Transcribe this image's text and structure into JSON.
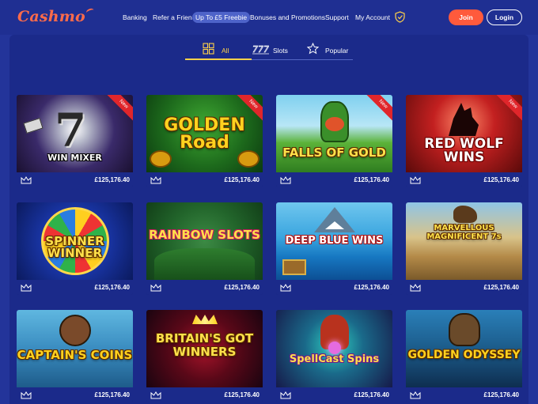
{
  "header": {
    "logo": "Cashmo",
    "nav": [
      {
        "label": "Banking"
      },
      {
        "label": "Refer a Friend"
      },
      {
        "label": "Up To £5 Freebie"
      },
      {
        "label": "Bonuses and Promotions"
      },
      {
        "label": "Support"
      },
      {
        "label": "My Account"
      }
    ],
    "join": "Join",
    "login": "Login",
    "icons": {
      "shield": "shield-check-icon"
    }
  },
  "filters": {
    "tabs": [
      {
        "label": "All",
        "icon": "grid-icon",
        "active": true
      },
      {
        "label": "Slots",
        "icon": "777-icon",
        "active": false
      },
      {
        "label": "Popular",
        "icon": "star-icon",
        "active": false
      }
    ]
  },
  "games": [
    {
      "title": "WIN MIXER",
      "jackpot": "£125,176.40",
      "new_badge": "New"
    },
    {
      "title": "GOLDEN Road",
      "jackpot": "£125,176.40",
      "new_badge": "New"
    },
    {
      "title": "FALLS OF GOLD",
      "jackpot": "£125,176.40",
      "new_badge": "New"
    },
    {
      "title": "RED WOLF WINS",
      "jackpot": "£125,176.40",
      "new_badge": "New"
    },
    {
      "title": "SPINNER WINNER",
      "jackpot": "£125,176.40"
    },
    {
      "title": "RAINBOW SLOTS",
      "jackpot": "£125,176.40"
    },
    {
      "title": "DEEP BLUE WINS",
      "jackpot": "£125,176.40"
    },
    {
      "title": "MARVELLOUS MAGNIFICENT 7s",
      "jackpot": "£125,176.40"
    },
    {
      "title": "CAPTAIN'S COINS",
      "jackpot": "£125,176.40"
    },
    {
      "title": "BRITAIN'S GOT WINNERS",
      "jackpot": "£125,176.40"
    },
    {
      "title": "SpellCast Spins",
      "jackpot": "£125,176.40"
    },
    {
      "title": "GOLDEN ODYSSEY",
      "jackpot": "£125,176.40"
    }
  ],
  "colors": {
    "background": "#23349a",
    "panel": "#1b2a8a",
    "accent": "#ff5a3c",
    "active_tab": "#ffd24a"
  }
}
